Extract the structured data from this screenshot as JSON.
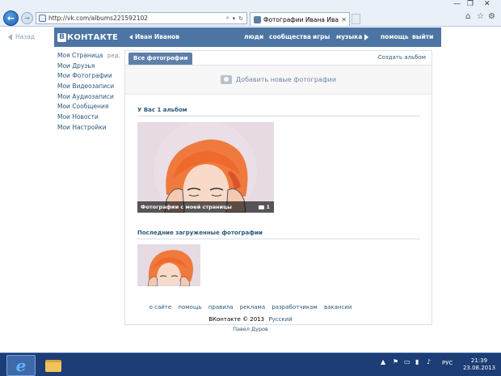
{
  "browser": {
    "url": "http://vk.com/albums221592102",
    "tab_title": "Фотографии Ивана Ивано...",
    "back_icon": "back-arrow-icon",
    "forward_icon": "forward-arrow-icon"
  },
  "page": {
    "back_label": "Назад",
    "header": {
      "logo_letter": "В",
      "logo_text": "КОНТАКТЕ",
      "user_name": "Иван Иванов",
      "nav": [
        "люди",
        "сообщества",
        "игры",
        "музыка",
        "помощь",
        "выйти"
      ]
    },
    "menu": {
      "items": [
        "Моя Страница",
        "Мои Друзья",
        "Мои Фотографии",
        "Мои Видеозаписи",
        "Мои Аудиозаписи",
        "Мои Сообщения",
        "Мои Новости",
        "Мои Настройки"
      ],
      "edit_label": "ред."
    },
    "photos": {
      "tab_all": "Все фотографии",
      "create_album": "Создать альбом",
      "add_photos": "Добавить новые фотографии",
      "albums_heading": "У Вас 1 альбом",
      "album": {
        "caption": "Фотографии с моей страницы",
        "count": "1"
      },
      "recent_heading": "Последние загруженные фотографии"
    },
    "footer": {
      "links": [
        "о сайте",
        "помощь",
        "правила",
        "реклама",
        "разработчикам",
        "вакансии"
      ],
      "copyright": "ВКонтакте © 2013",
      "language": "Русский",
      "author": "Павел Дуров"
    }
  },
  "taskbar": {
    "language": "РУС",
    "time": "21:39",
    "date": "23.08.2013"
  },
  "colors": {
    "vk_blue": "#4c75a3",
    "link": "#2b587a",
    "taskbar": "#1c3d75"
  }
}
